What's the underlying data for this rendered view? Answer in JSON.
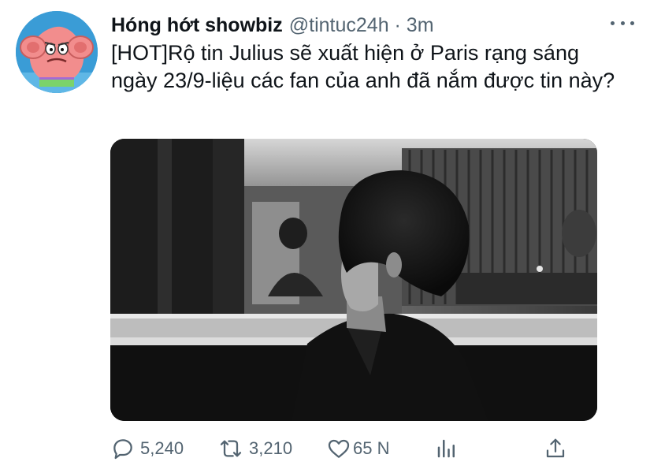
{
  "tweet": {
    "display_name": "Hóng hớt showbiz",
    "handle": "@tintuc24h · 3m",
    "text": "[HOT]Rộ tin Julius sẽ xuất hiện ở Paris rạng sáng ngày 23/9-liệu các fan của anh đã nắm được tin này?"
  },
  "icons": {
    "avatar": "cartoon-starfish-avatar",
    "more": "more-horizontal-icon",
    "reply": "reply-icon",
    "retweet": "retweet-icon",
    "like": "heart-icon",
    "analytics": "analytics-icon",
    "share": "share-icon"
  },
  "actions": {
    "reply_count": "5,240",
    "retweet_count": "3,210",
    "like_count": "65 N"
  },
  "colors": {
    "text": "#0f1419",
    "secondary": "#536471",
    "avatar_bg": "#3a9cd6",
    "avatar_character": "#f28d8d"
  }
}
